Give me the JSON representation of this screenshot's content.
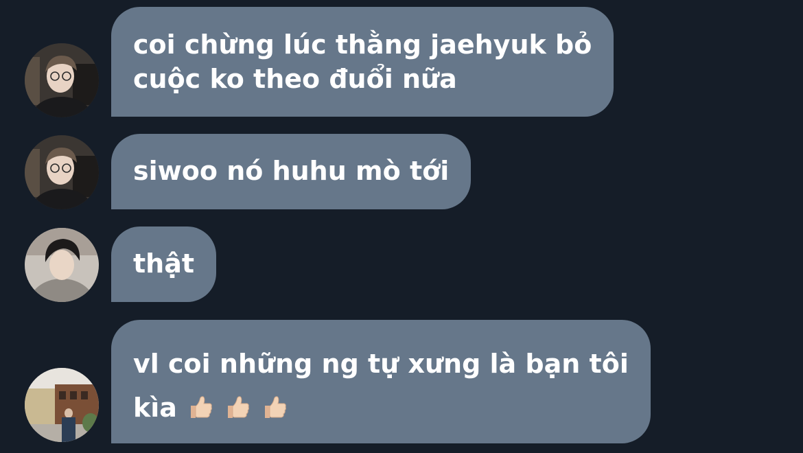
{
  "colors": {
    "background": "#151d28",
    "bubble": "#66778a",
    "text": "#ffffff"
  },
  "messages": [
    {
      "avatar": "avatar-glasses-man",
      "lines": [
        "coi chừng lúc thằng jaehyuk bỏ",
        "cuộc ko theo đuổi nữa"
      ]
    },
    {
      "avatar": "avatar-glasses-man",
      "lines": [
        "siwoo nó huhu mò tới"
      ]
    },
    {
      "avatar": "avatar-young-man-hoodie",
      "lines": [
        "thật"
      ]
    },
    {
      "avatar": "avatar-street-photo",
      "lines": [
        "vl coi những ng tự xưng là bạn tôi",
        "kìa"
      ],
      "emoji": [
        "thumbs-up-emoji",
        "thumbs-up-emoji",
        "thumbs-up-emoji"
      ]
    }
  ]
}
